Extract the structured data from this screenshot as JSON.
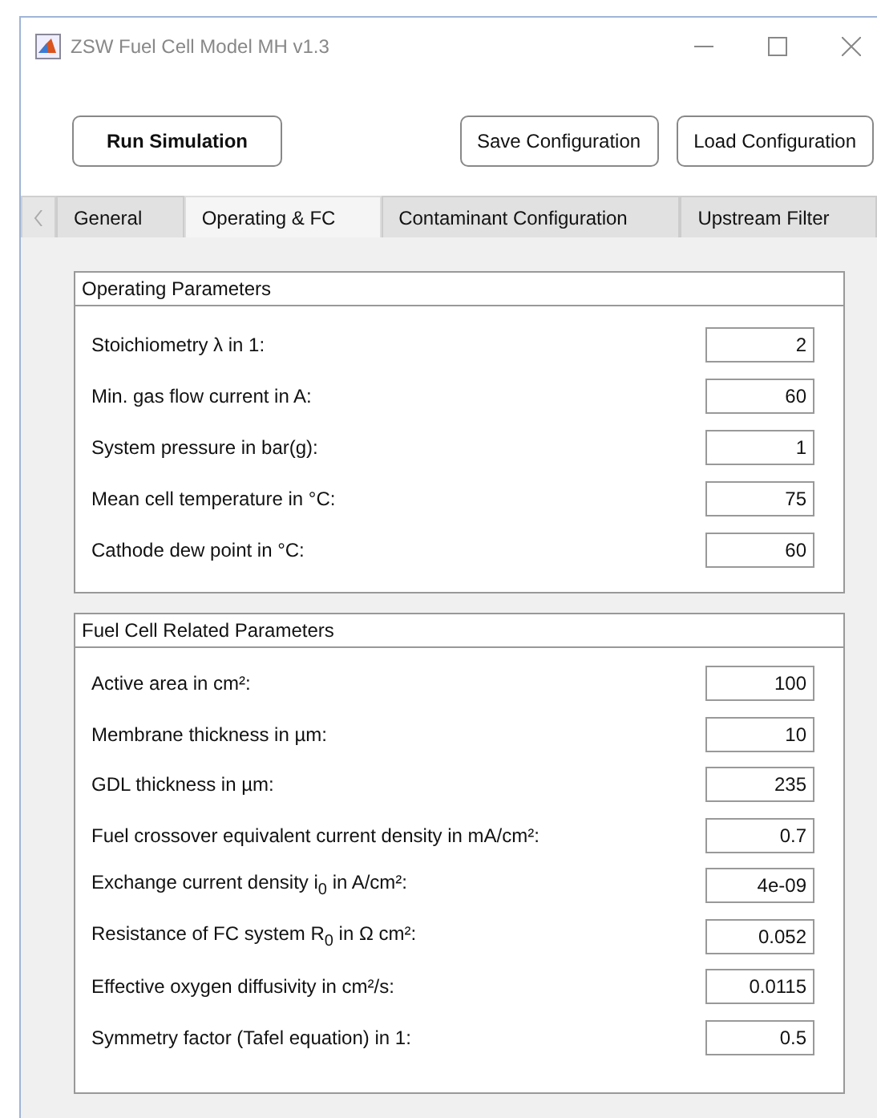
{
  "window": {
    "title": "ZSW Fuel Cell Model MH v1.3"
  },
  "toolbar": {
    "buttons": [
      {
        "label": "Run Simulation",
        "kind": "primary"
      },
      {
        "label": "Save Configuration",
        "kind": "normal"
      },
      {
        "label": "Load Configuration",
        "kind": "normal"
      }
    ]
  },
  "tabs": [
    {
      "label": "General",
      "selected": false
    },
    {
      "label": "Operating & FC",
      "selected": true
    },
    {
      "label": "Contaminant Configuration",
      "selected": false
    },
    {
      "label": "Upstream Filter",
      "selected": false
    }
  ],
  "panels": [
    {
      "title": "Operating Parameters",
      "fields": [
        {
          "label": "Stoichiometry λ in 1:",
          "value": "2"
        },
        {
          "label": "Min. gas flow current in A:",
          "value": "60"
        },
        {
          "label": "System pressure in bar(g):",
          "value": "1"
        },
        {
          "label": "Mean cell temperature in °C:",
          "value": "75"
        },
        {
          "label": "Cathode dew point in °C:",
          "value": "60"
        }
      ]
    },
    {
      "title": "Fuel Cell Related Parameters",
      "fields": [
        {
          "label": "Active area in cm²:",
          "value": "100"
        },
        {
          "label": "Membrane thickness in µm:",
          "value": "10"
        },
        {
          "label": "GDL thickness in µm:",
          "value": "235"
        },
        {
          "label": "Fuel crossover equivalent current density in mA/cm²:",
          "value": "0.7"
        },
        {
          "label": "Exchange current density i$_{0}$ in A/cm²:",
          "value": "4e-09"
        },
        {
          "label": "Resistance of FC system R$_{0}$ in Ω cm²:",
          "value": "0.052"
        },
        {
          "label": "Effective oxygen diffusivity in cm²/s:",
          "value": "0.0115"
        },
        {
          "label": "Symmetry factor (Tafel equation) in 1:",
          "value": "0.5"
        }
      ]
    }
  ]
}
